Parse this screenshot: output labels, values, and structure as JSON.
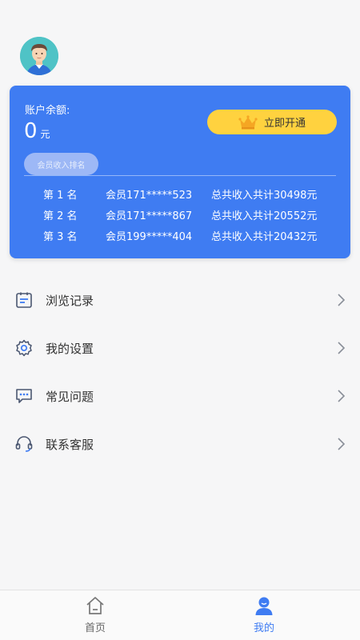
{
  "profile": {
    "avatar_icon": "user-avatar"
  },
  "balance_card": {
    "label": "账户余额:",
    "value": "0",
    "unit": "元",
    "vip_button_label": "立即开通",
    "ranking_tab_label": "会员收入排名",
    "rankings": [
      {
        "place": "第 1 名",
        "member": "会员171*****523",
        "income": "总共收入共计30498元"
      },
      {
        "place": "第 2 名",
        "member": "会员171*****867",
        "income": "总共收入共计20552元"
      },
      {
        "place": "第 3 名",
        "member": "会员199*****404",
        "income": "总共收入共计20432元"
      }
    ]
  },
  "menu": {
    "items": [
      {
        "label": "浏览记录",
        "icon": "calendar-icon"
      },
      {
        "label": "我的设置",
        "icon": "gear-icon"
      },
      {
        "label": "常见问题",
        "icon": "chat-icon"
      },
      {
        "label": "联系客服",
        "icon": "headset-icon"
      }
    ]
  },
  "bottom_nav": {
    "items": [
      {
        "label": "首页",
        "icon": "home-icon",
        "active": false
      },
      {
        "label": "我的",
        "icon": "user-icon",
        "active": true
      }
    ]
  },
  "colors": {
    "accent": "#3f7cf2",
    "vip_button": "#ffd23f",
    "background": "#f6f6f7"
  }
}
